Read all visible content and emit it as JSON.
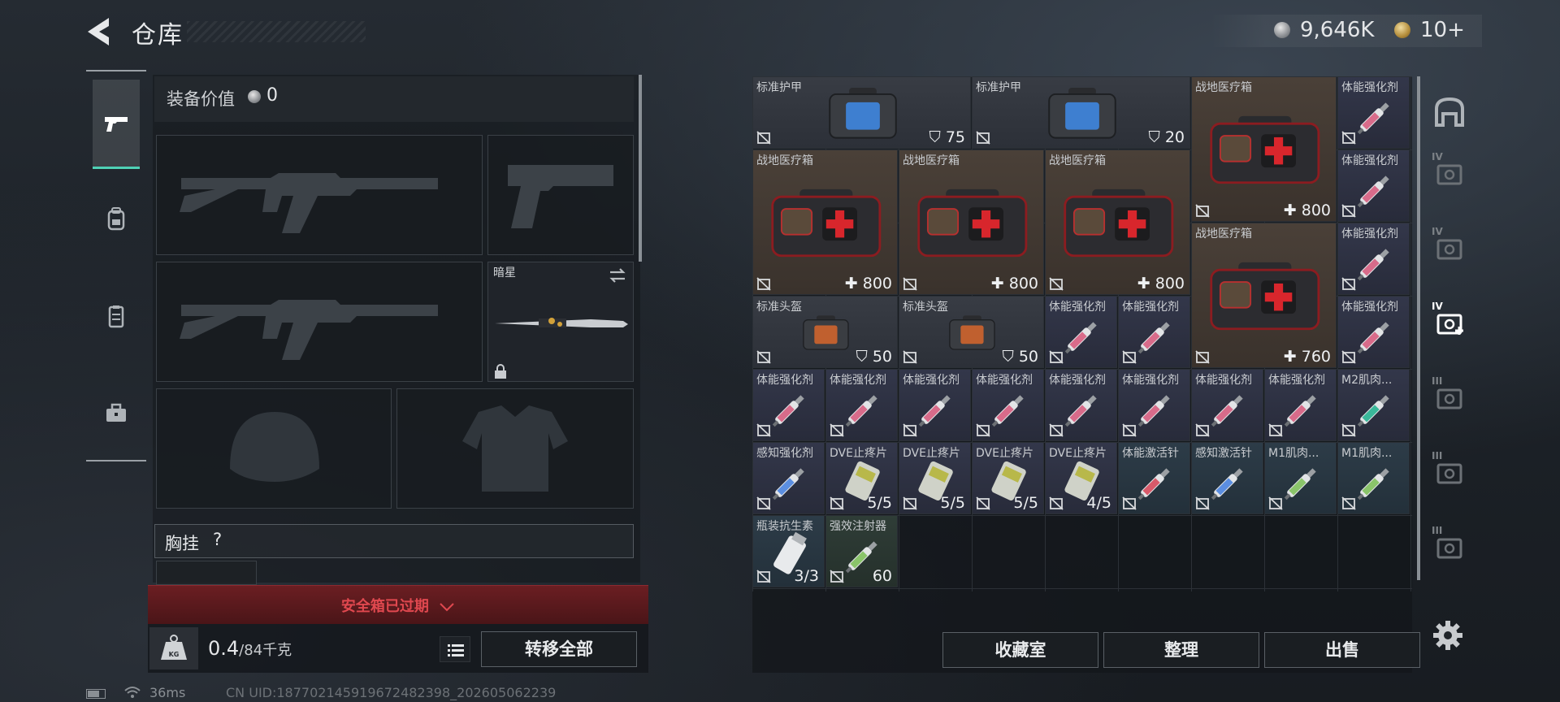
{
  "header": {
    "title": "仓库",
    "silver_amount": "9,646K",
    "gold_amount": "10+"
  },
  "equipment": {
    "value_label": "装备价值",
    "value": "0",
    "melee_name": "暗星",
    "chest_rig_label": "胸挂",
    "chest_rig_help": "?",
    "safe_box_status": "安全箱已过期",
    "weight_current": "0.4",
    "weight_max": "/84千克",
    "weight_icon_text": "KG",
    "transfer_all": "转移全部"
  },
  "stash": {
    "items": [
      {
        "name": "标准护甲",
        "value": "75",
        "kind": "armor",
        "bg": "gray"
      },
      {
        "name": "标准护甲",
        "value": "20",
        "kind": "armor",
        "bg": "gray"
      },
      {
        "name": "战地医疗箱",
        "value": "800",
        "kind": "medkit",
        "bg": "brown"
      },
      {
        "name": "体能强化剂",
        "value": "",
        "kind": "syringe",
        "bg": "dblue"
      },
      {
        "name": "战地医疗箱",
        "value": "800",
        "kind": "medkit",
        "bg": "brown"
      },
      {
        "name": "战地医疗箱",
        "value": "800",
        "kind": "medkit",
        "bg": "brown"
      },
      {
        "name": "战地医疗箱",
        "value": "800",
        "kind": "medkit",
        "bg": "brown"
      },
      {
        "name": "体能强化剂",
        "value": "",
        "kind": "syringe",
        "bg": "dblue"
      },
      {
        "name": "战地医疗箱",
        "value": "760",
        "kind": "medkit",
        "bg": "brown"
      },
      {
        "name": "体能强化剂",
        "value": "",
        "kind": "syringe",
        "bg": "dblue"
      },
      {
        "name": "标准头盔",
        "value": "50",
        "kind": "helmet",
        "bg": "gray"
      },
      {
        "name": "标准头盔",
        "value": "50",
        "kind": "helmet",
        "bg": "gray"
      },
      {
        "name": "体能强化剂",
        "value": "",
        "kind": "syringe",
        "bg": "dblue"
      },
      {
        "name": "体能强化剂",
        "value": "",
        "kind": "syringe",
        "bg": "dblue"
      },
      {
        "name": "体能强化剂",
        "value": "",
        "kind": "syringe",
        "bg": "dblue"
      },
      {
        "name": "体能强化剂",
        "value": "",
        "kind": "syringe",
        "bg": "dblue"
      },
      {
        "name": "体能强化剂",
        "value": "",
        "kind": "syringe",
        "bg": "dblue"
      },
      {
        "name": "体能强化剂",
        "value": "",
        "kind": "syringe",
        "bg": "dblue"
      },
      {
        "name": "体能强化剂",
        "value": "",
        "kind": "syringe",
        "bg": "dblue"
      },
      {
        "name": "体能强化剂",
        "value": "",
        "kind": "syringe",
        "bg": "dblue"
      },
      {
        "name": "体能强化剂",
        "value": "",
        "kind": "syringe",
        "bg": "dblue"
      },
      {
        "name": "体能强化剂",
        "value": "",
        "kind": "syringe",
        "bg": "dblue"
      },
      {
        "name": "体能强化剂",
        "value": "",
        "kind": "syringe",
        "bg": "dblue"
      },
      {
        "name": "M2肌肉...",
        "value": "",
        "kind": "syringe-teal",
        "bg": "dblue"
      },
      {
        "name": "感知强化剂",
        "value": "",
        "kind": "syringe-blue",
        "bg": "dblue"
      },
      {
        "name": "DVE止疼片",
        "value": "5/5",
        "kind": "pills",
        "bg": "dblue"
      },
      {
        "name": "DVE止疼片",
        "value": "5/5",
        "kind": "pills",
        "bg": "dblue"
      },
      {
        "name": "DVE止疼片",
        "value": "5/5",
        "kind": "pills",
        "bg": "dblue"
      },
      {
        "name": "DVE止疼片",
        "value": "4/5",
        "kind": "pills",
        "bg": "dblue"
      },
      {
        "name": "体能激活针",
        "value": "",
        "kind": "syringe-red",
        "bg": "teal"
      },
      {
        "name": "感知激活针",
        "value": "",
        "kind": "syringe-blue",
        "bg": "teal"
      },
      {
        "name": "M1肌肉...",
        "value": "",
        "kind": "syringe-green",
        "bg": "teal"
      },
      {
        "name": "M1肌肉...",
        "value": "",
        "kind": "syringe-green",
        "bg": "teal"
      },
      {
        "name": "瓶装抗生素",
        "value": "3/3",
        "kind": "bottle",
        "bg": "teal"
      },
      {
        "name": "强效注射器",
        "value": "60",
        "kind": "syringe-green",
        "bg": "green"
      }
    ],
    "buttons": {
      "collection": "收藏室",
      "organize": "整理",
      "sell": "出售"
    }
  },
  "side_tabs": [
    "IV",
    "IV",
    "IV",
    "III",
    "III",
    "III"
  ],
  "status": {
    "latency": "36ms",
    "uid": "CN UID:18770214591967248239​8_202605062239"
  },
  "colors": {
    "accent": "#4fd1b5",
    "alert": "#e0484f",
    "medkit_red": "#d8262c"
  }
}
